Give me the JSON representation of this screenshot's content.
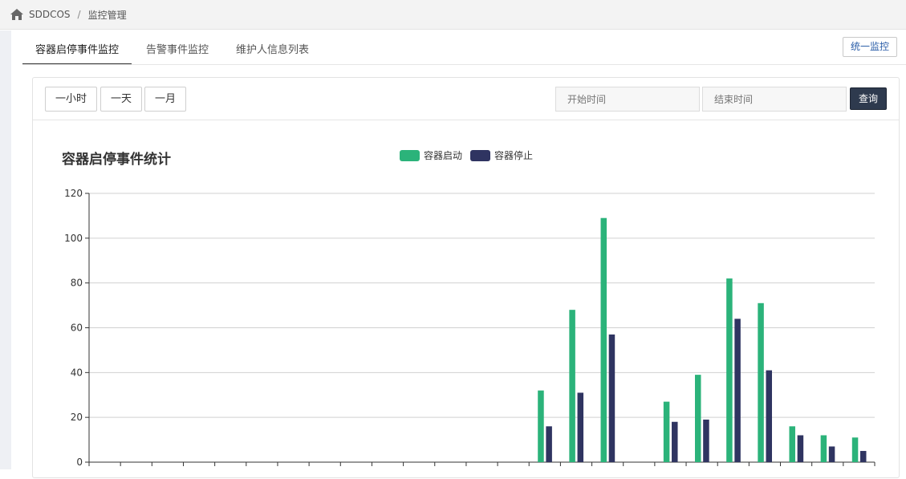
{
  "breadcrumb": {
    "items": [
      "SDDCOS",
      "监控管理"
    ],
    "separator": "/"
  },
  "tabs": [
    {
      "label": "容器启停事件监控",
      "active": true
    },
    {
      "label": "告警事件监控",
      "active": false
    },
    {
      "label": "维护人信息列表",
      "active": false
    }
  ],
  "unified_button": "统一监控",
  "filters": {
    "ranges": [
      "一小时",
      "一天",
      "一月"
    ],
    "start_placeholder": "开始时间",
    "end_placeholder": "结束时间",
    "query_label": "查询"
  },
  "colors": {
    "start": "#2bb37a",
    "stop": "#2f3461"
  },
  "chart_data": {
    "type": "bar",
    "title": "容器启停事件统计",
    "ylim": [
      0,
      120
    ],
    "yticks": [
      0,
      20,
      40,
      60,
      80,
      100,
      120
    ],
    "grid": true,
    "legend_position": "top-center",
    "category_count": 25,
    "series": [
      {
        "name": "容器启动",
        "values": [
          0,
          0,
          0,
          0,
          0,
          0,
          0,
          0,
          0,
          0,
          0,
          0,
          0,
          0,
          32,
          68,
          109,
          0,
          27,
          39,
          82,
          71,
          16,
          12,
          11
        ]
      },
      {
        "name": "容器停止",
        "values": [
          0,
          0,
          0,
          0,
          0,
          0,
          0,
          0,
          0,
          0,
          0,
          0,
          0,
          0,
          16,
          31,
          57,
          0,
          18,
          19,
          64,
          41,
          12,
          7,
          5
        ]
      }
    ]
  }
}
